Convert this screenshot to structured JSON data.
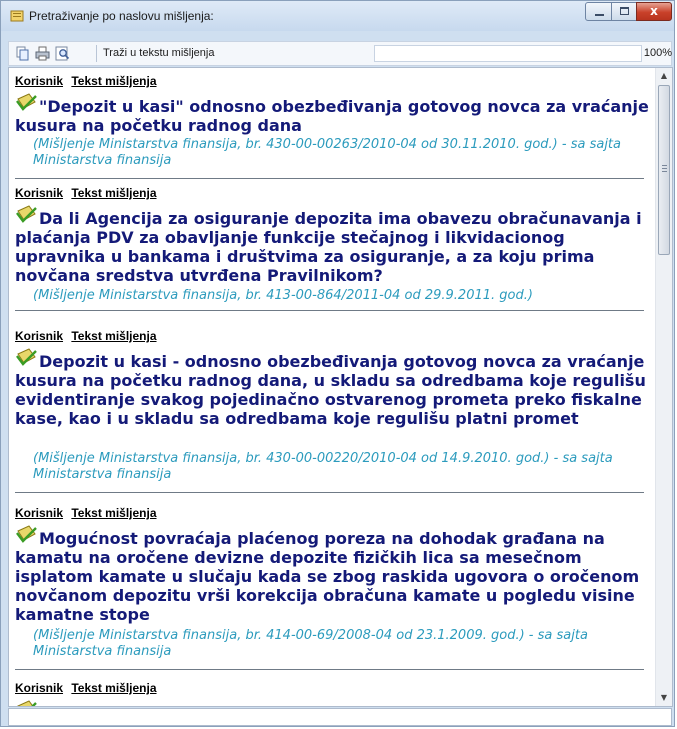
{
  "window": {
    "title": "Pretraživanje po naslovu mišljenja:",
    "minimize": "minimize",
    "maximize": "maximize",
    "close": "x"
  },
  "toolbar": {
    "search_in_text": "Traži u tekstu mišljenja",
    "search_value": "",
    "zoom": "100%"
  },
  "entries": [
    {
      "links": [
        "Korisnik",
        "Tekst mišljenja"
      ],
      "title": "\"Depozit u kasi\" odnosno obezbeđivanja gotovog novca za vraćanje kusura na početku radnog dana",
      "source": "(Mišljenje Ministarstva finansija, br. 430-00-00263/2010-04 od 30.11.2010. god.) - sa sajta Ministarstva finansija"
    },
    {
      "links": [
        "Korisnik",
        "Tekst mišljenja"
      ],
      "title": "Da li Agencija za osiguranje depozita ima obavezu obračunavanja i plaćanja PDV za obavljanje funkcije stečajnog i likvidacionog upravnika u bankama i društvima za osiguranje, a za koju prima novčana sredstva utvrđena Pravilnikom?",
      "source": "(Mišljenje Ministarstva finansija, br. 413-00-864/2011-04 od 29.9.2011. god.)"
    },
    {
      "links": [
        "Korisnik",
        "Tekst mišljenja"
      ],
      "title": "Depozit u kasi - odnosno obezbeđivanja gotovog novca za vraćanje kusura na početku radnog dana, u skladu sa odredbama koje regulišu evidentiranje svakog pojedinačno ostvarenog prometa preko fiskalne kase, kao i u skladu sa odredbama koje regulišu platni promet",
      "source": "(Mišljenje Ministarstva finansija, br. 430-00-00220/2010-04 od 14.9.2010. god.) - sa sajta Ministarstva finansija"
    },
    {
      "links": [
        "Korisnik",
        "Tekst mišljenja"
      ],
      "title": "Mogućnost povraćaja plaćenog poreza na dohodak građana na kamatu na oročene devizne depozite fizičkih lica sa mesečnom isplatom kamate u slučaju kada se zbog raskida ugovora o oročenom novčanom depozitu vrši korekcija obračuna kamate u pogledu visine kamatne stope",
      "source": "(Mišljenje Ministarstva finansija, br. 414-00-69/2008-04 od 23.1.2009. god.) - sa sajta Ministarstva finansija"
    },
    {
      "links": [
        "Korisnik",
        "Tekst mišljenja"
      ],
      "title": "",
      "source": ""
    }
  ],
  "colors": {
    "title": "#141a78",
    "source": "#2c9bbd",
    "titlebar": "#c7d9ee"
  }
}
